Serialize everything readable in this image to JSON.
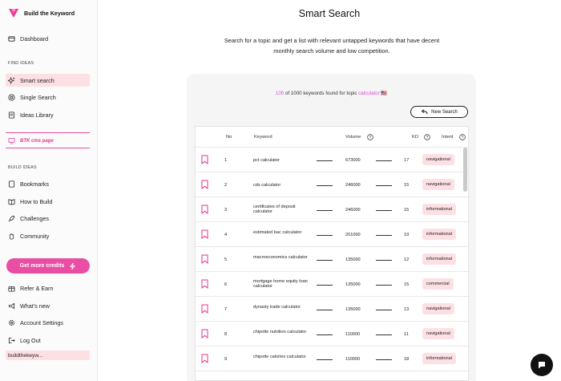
{
  "brand": {
    "name": "Build the Keyword"
  },
  "sidebar": {
    "dashboard": "Dashboard",
    "find_ideas_label": "FIND IDEAS",
    "find_ideas": [
      "Smart search",
      "Single Search",
      "Ideas Library"
    ],
    "cms_link": "BTK cms page",
    "build_ideas_label": "BUILD IDEAS",
    "build_ideas": [
      "Bookmarks",
      "How to Build",
      "Challenges",
      "Community"
    ],
    "credits_button": "Get more credits",
    "bottom": [
      "Refer & Earn",
      "What's new",
      "Account Settings",
      "Log Out"
    ],
    "user": "buildthekeyw..."
  },
  "main": {
    "title": "Smart Search",
    "subtitle": "Search for a topic and get a list with relevant untapped keywords that have decent monthly search volume and low competition.",
    "found": {
      "count": "100",
      "of": "of",
      "total": "1000 keywords found for topic",
      "topic": "calculator",
      "flag": "🇺🇸"
    },
    "new_search": "New Search"
  },
  "table": {
    "headers": {
      "no": "No",
      "keyword": "Keyword",
      "volume": "Volume",
      "kd": "KD",
      "intent": "Intent"
    },
    "rows": [
      {
        "no": "1",
        "keyword": "pct calculator",
        "volume": "673000",
        "kd": "17",
        "intent": "navigational"
      },
      {
        "no": "2",
        "keyword": "cds calculator",
        "volume": "246000",
        "kd": "15",
        "intent": "navigational"
      },
      {
        "no": "3",
        "keyword": "certificates of deposit calculator",
        "volume": "246000",
        "kd": "15",
        "intent": "informational"
      },
      {
        "no": "4",
        "keyword": "estimated bac calculator",
        "volume": "201000",
        "kd": "19",
        "intent": "informational"
      },
      {
        "no": "5",
        "keyword": "macroeconomics calculator",
        "volume": "135000",
        "kd": "12",
        "intent": "informational"
      },
      {
        "no": "6",
        "keyword": "mortgage home equity loan calculator",
        "volume": "135000",
        "kd": "15",
        "intent": "commercial"
      },
      {
        "no": "7",
        "keyword": "dynasty trade calculator",
        "volume": "135000",
        "kd": "13",
        "intent": "navigational"
      },
      {
        "no": "8",
        "keyword": "chipotle nutrition calculator",
        "volume": "110000",
        "kd": "11",
        "intent": "navigational"
      },
      {
        "no": "9",
        "keyword": "chipotle calories calculator",
        "volume": "110000",
        "kd": "18",
        "intent": "informational"
      }
    ]
  },
  "colors": {
    "accent": "#ea4ea4",
    "active_bg": "#fde0e4",
    "topic": "#d94fd0"
  }
}
